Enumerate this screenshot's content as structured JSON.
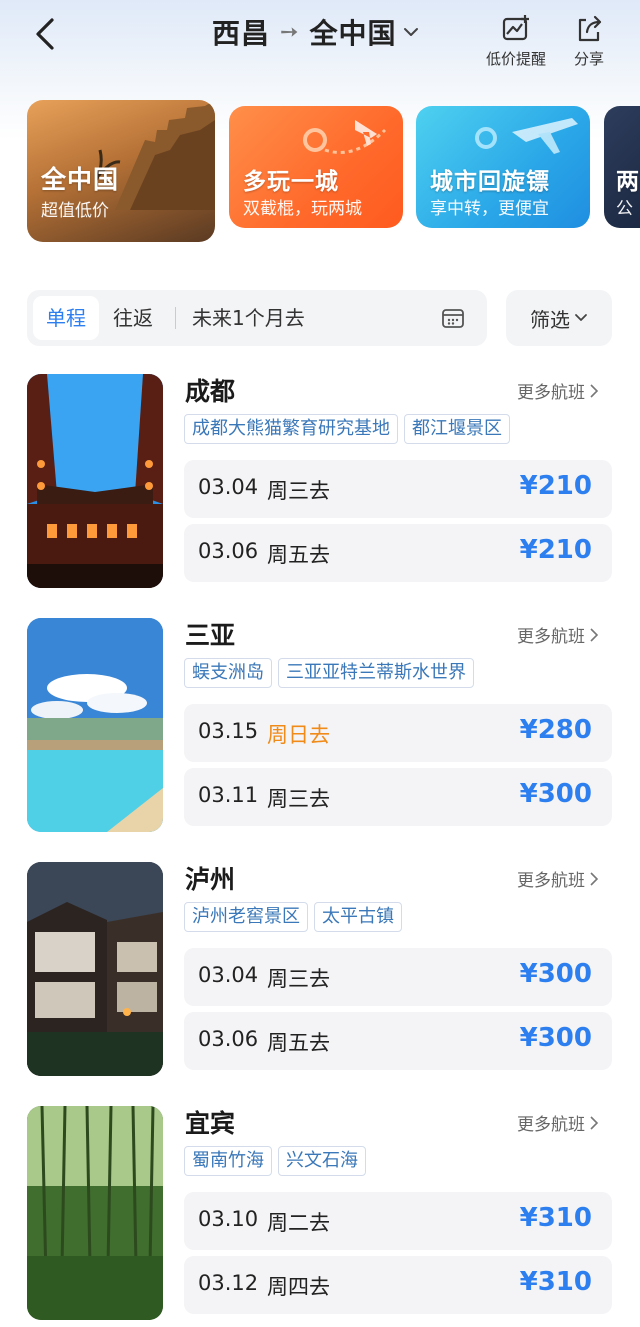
{
  "header": {
    "origin": "西昌",
    "destination": "全中国",
    "actions": {
      "low_price_alert": "低价提醒",
      "share": "分享"
    }
  },
  "banners": [
    {
      "title": "全中国",
      "subtitle": "超值低价"
    },
    {
      "title": "多玩一城",
      "subtitle": "双截棍，玩两城"
    },
    {
      "title": "城市回旋镖",
      "subtitle": "享中转，更便宜"
    },
    {
      "title": "两",
      "subtitle": "公"
    }
  ],
  "filter": {
    "tabs": [
      "单程",
      "往返"
    ],
    "active_tab": "单程",
    "period": "未来1个月去",
    "screen_label": "筛选"
  },
  "more_label": "更多航班",
  "cities": [
    {
      "name": "成都",
      "tags": [
        "成都大熊猫繁育研究基地",
        "都江堰景区"
      ],
      "flights": [
        {
          "date": "03.04",
          "day": "周三去",
          "price": "¥210"
        },
        {
          "date": "03.06",
          "day": "周五去",
          "price": "¥210"
        }
      ]
    },
    {
      "name": "三亚",
      "tags": [
        "蜈支洲岛",
        "三亚亚特兰蒂斯水世界"
      ],
      "flights": [
        {
          "date": "03.15",
          "day": "周日去",
          "price": "¥280",
          "highlight": true
        },
        {
          "date": "03.11",
          "day": "周三去",
          "price": "¥300"
        }
      ]
    },
    {
      "name": "泸州",
      "tags": [
        "泸州老窖景区",
        "太平古镇"
      ],
      "flights": [
        {
          "date": "03.04",
          "day": "周三去",
          "price": "¥300"
        },
        {
          "date": "03.06",
          "day": "周五去",
          "price": "¥300"
        }
      ]
    },
    {
      "name": "宜宾",
      "tags": [
        "蜀南竹海",
        "兴文石海"
      ],
      "flights": [
        {
          "date": "03.10",
          "day": "周二去",
          "price": "¥310"
        },
        {
          "date": "03.12",
          "day": "周四去",
          "price": "¥310"
        }
      ]
    }
  ],
  "colors": {
    "accent": "#2d7ff0",
    "highlight": "#f08a18",
    "tag_text": "#3b78b9"
  }
}
